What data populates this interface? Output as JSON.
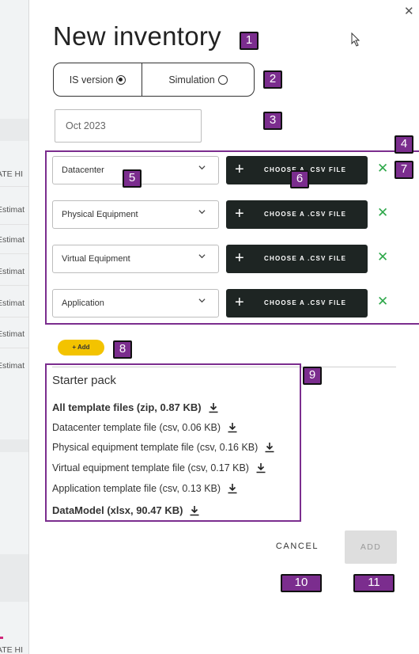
{
  "background": {
    "labels": [
      "ATE HI",
      "Estimat",
      "Estimat",
      "Estimat",
      "Estimat",
      "Estimat",
      "Estimat",
      "ATE HI"
    ]
  },
  "dialog": {
    "title": "New inventory",
    "close_icon": "close-icon",
    "toggle": {
      "option_1": "IS version",
      "option_2": "Simulation",
      "selected": "IS version"
    },
    "date": {
      "value": "Oct 2023"
    },
    "files": [
      {
        "type": "Datacenter",
        "button": "CHOOSE A .CSV FILE"
      },
      {
        "type": "Physical Equipment",
        "button": "CHOOSE A .CSV FILE"
      },
      {
        "type": "Virtual Equipment",
        "button": "CHOOSE A .CSV FILE"
      },
      {
        "type": "Application",
        "button": "CHOOSE A .CSV FILE"
      }
    ],
    "add_file_label": "+ Add",
    "starter_pack": {
      "title": "Starter pack",
      "items": [
        "All template files (zip, 0.87 KB)",
        "Datacenter template file (csv, 0.06 KB)",
        "Physical equipment template file (csv, 0.16 KB)",
        "Virtual equipment template file (csv, 0.17 KB)",
        "Application template file (csv, 0.13 KB)",
        "DataModel (xlsx, 90.47 KB)"
      ]
    },
    "cancel_label": "CANCEL",
    "add_label": "ADD"
  },
  "annotations": [
    "1",
    "2",
    "3",
    "4",
    "5",
    "6",
    "7",
    "8",
    "9",
    "10",
    "11"
  ],
  "colors": {
    "accent_dark": "#1e2523",
    "add_yellow": "#f3c300",
    "remove_green": "#2ea84a",
    "annotation_purple": "#7b2d8e"
  }
}
